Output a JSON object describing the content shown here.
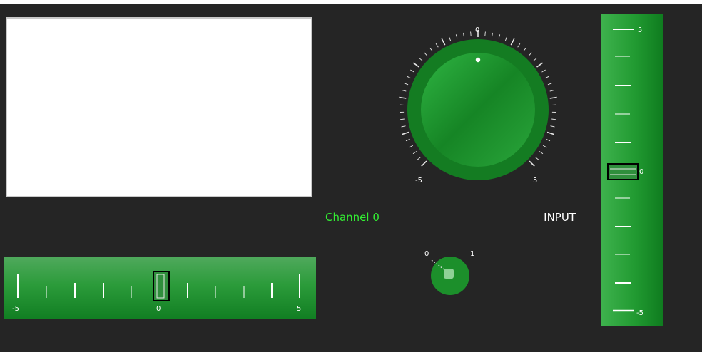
{
  "colors": {
    "background": "#252525",
    "accent_green": "#1f9a2e",
    "channel_text": "#33ee33",
    "label_text": "#ffffff"
  },
  "display": {},
  "horizontal_slider": {
    "min_label": "-5",
    "mid_label": "0",
    "max_label": "5",
    "value": 0
  },
  "big_knob": {
    "top_label": "0",
    "min_label": "-5",
    "max_label": "5",
    "value": 0
  },
  "channel": {
    "name": "Channel 0",
    "mode": "INPUT"
  },
  "small_knob": {
    "min_label": "0",
    "max_label": "1",
    "value": 0
  },
  "vertical_slider": {
    "top_label": "5",
    "mid_label": "0",
    "bottom_label": "-5",
    "value": 0
  }
}
